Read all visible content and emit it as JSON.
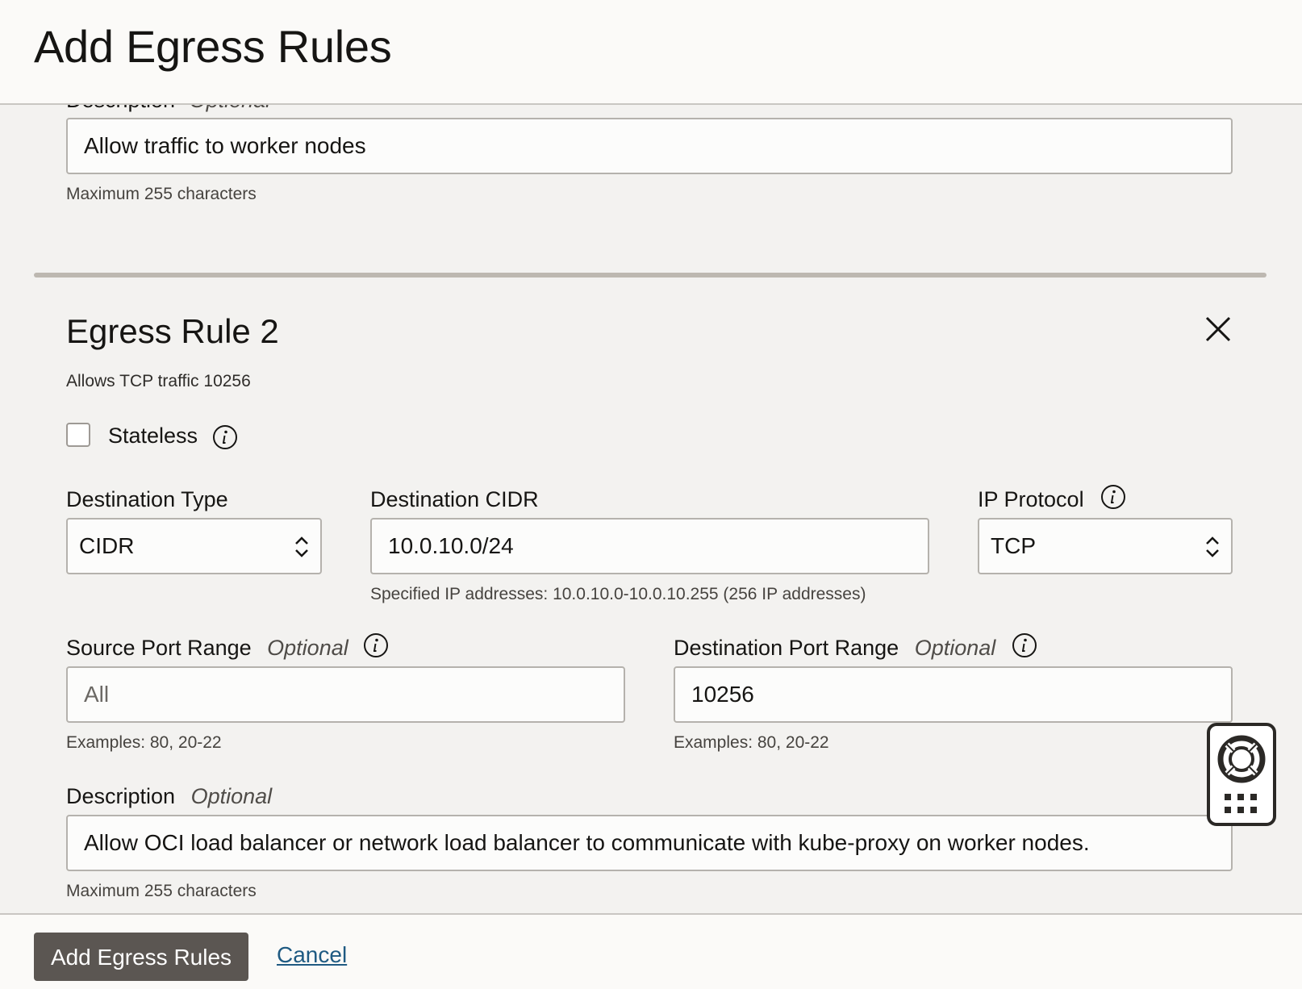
{
  "page": {
    "title": "Add Egress Rules"
  },
  "rule1": {
    "description_label": "Description",
    "description_optional": "Optional",
    "description_value": "Allow traffic to worker nodes",
    "description_help": "Maximum 255 characters"
  },
  "rule2": {
    "title": "Egress Rule 2",
    "summary": "Allows TCP traffic 10256",
    "stateless_label": "Stateless",
    "stateless_checked": false,
    "destination_type": {
      "label": "Destination Type",
      "value": "CIDR"
    },
    "destination_cidr": {
      "label": "Destination CIDR",
      "value": "10.0.10.0/24",
      "help": "Specified IP addresses: 10.0.10.0-10.0.10.255 (256 IP addresses)"
    },
    "ip_protocol": {
      "label": "IP Protocol",
      "value": "TCP"
    },
    "source_port_range": {
      "label": "Source Port Range",
      "optional": "Optional",
      "placeholder": "All",
      "help": "Examples: 80, 20-22"
    },
    "destination_port_range": {
      "label": "Destination Port Range",
      "optional": "Optional",
      "value": "10256",
      "help": "Examples: 80, 20-22"
    },
    "description": {
      "label": "Description",
      "optional": "Optional",
      "value": "Allow OCI load balancer or network load balancer to communicate with kube-proxy on worker nodes.",
      "help": "Maximum 255 characters"
    }
  },
  "footer": {
    "submit_label": "Add Egress Rules",
    "cancel_label": "Cancel"
  },
  "colors": {
    "primary_button": "#5b5652",
    "link": "#1f5a82",
    "panel_bg": "#f3f2f0"
  },
  "icons": {
    "info": "info-icon",
    "close": "close-icon",
    "help": "lifebuoy-icon",
    "grid": "dots-grid-icon",
    "chevron": "up-down-chevron-icon"
  }
}
